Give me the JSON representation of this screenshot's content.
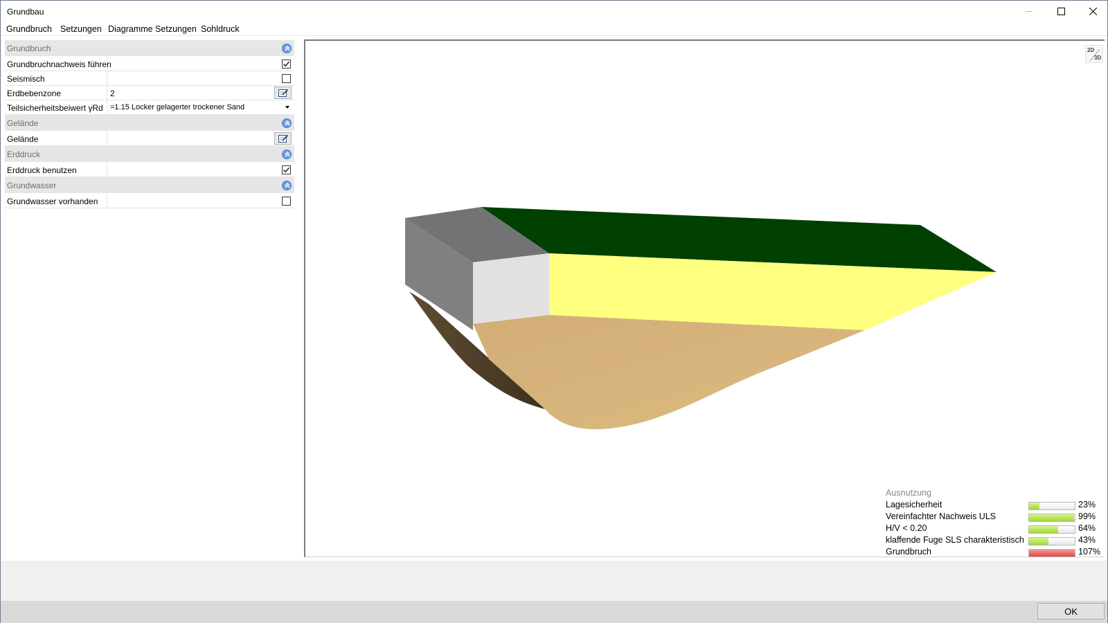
{
  "window": {
    "title": "Grundbau"
  },
  "menu": {
    "items": [
      "Grundbruch",
      "Setzungen",
      "Diagramme Setzungen",
      "Sohldruck"
    ]
  },
  "panel": {
    "sections": [
      {
        "title": "Grundbruch",
        "rows": [
          {
            "label": "Grundbruchnachweis führen",
            "control": "checkbox",
            "checked": true
          },
          {
            "label": "Seismisch",
            "control": "checkbox",
            "checked": false
          },
          {
            "label": "Erdbebenzone",
            "value": "2",
            "control": "edit"
          },
          {
            "label": "Teilsicherheitsbeiwert   γRd",
            "value": "=1.15 Locker gelagerter trockener Sand",
            "control": "dropdown"
          }
        ]
      },
      {
        "title": "Gelände",
        "rows": [
          {
            "label": "Gelände",
            "value": "",
            "control": "edit"
          }
        ]
      },
      {
        "title": "Erddruck",
        "rows": [
          {
            "label": "Erddruck benutzen",
            "control": "checkbox",
            "checked": true
          }
        ]
      },
      {
        "title": "Grundwasser",
        "rows": [
          {
            "label": "Grundwasser vorhanden",
            "control": "checkbox",
            "checked": false
          }
        ]
      }
    ]
  },
  "viewport": {
    "toggle_2d": "2D",
    "toggle_3d": "3D",
    "colors": {
      "terrain_top": "#004000",
      "terrain_front": "#ffff80",
      "foundation_top": "#737373",
      "foundation_front": "#e1e1e1",
      "foundation_side": "#808080",
      "failure_body": "#d8b47a",
      "failure_side": "#5a4a30"
    }
  },
  "utilization": {
    "title": "Ausnutzung",
    "items": [
      {
        "label": "Lagesicherheit",
        "percent_text": "23%",
        "value": 0.23,
        "exceeded": false
      },
      {
        "label": "Vereinfachter Nachweis ULS",
        "percent_text": "99%",
        "value": 0.99,
        "exceeded": false
      },
      {
        "label": "H/V < 0.20",
        "percent_text": "64%",
        "value": 0.64,
        "exceeded": false
      },
      {
        "label": "klaffende Fuge SLS charakteristisch",
        "percent_text": "43%",
        "value": 0.43,
        "exceeded": false
      },
      {
        "label": "Grundbruch",
        "percent_text": "107%",
        "value": 1.07,
        "exceeded": true
      }
    ]
  },
  "footer": {
    "ok_label": "OK"
  }
}
